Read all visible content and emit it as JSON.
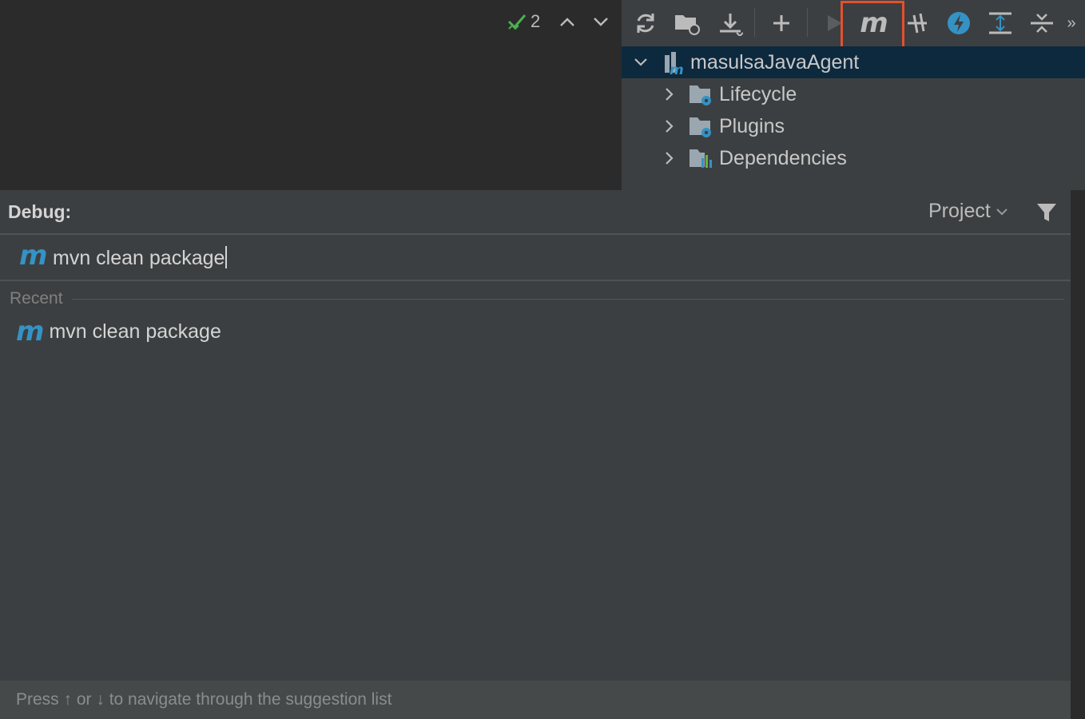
{
  "editor": {
    "inspection_count": "2",
    "colors": {
      "check": "#4caf50"
    }
  },
  "maven": {
    "toolbar": {
      "icons": [
        "refresh-icon",
        "reimport-folder-icon",
        "download-icon",
        "add-icon",
        "run-icon",
        "maven-command-icon",
        "skip-tests-icon",
        "offline-icon",
        "expand-all-icon",
        "collapse-all-icon",
        "more-icon"
      ],
      "maven_button_label": "m",
      "more_label": "»"
    },
    "tree": {
      "project": "masulsaJavaAgent",
      "children": [
        "Lifecycle",
        "Plugins",
        "Dependencies"
      ]
    },
    "colors": {
      "accent": "#3592c4",
      "selection": "#0d293e",
      "highlight": "#e4502f"
    }
  },
  "debug": {
    "title": "Debug:",
    "scope": "Project",
    "command_value": "mvn clean package",
    "recent_label": "Recent",
    "recent_items": [
      "mvn clean package"
    ],
    "hint": "Press ↑ or ↓ to navigate through the suggestion list",
    "maven_icon_label": "m"
  }
}
